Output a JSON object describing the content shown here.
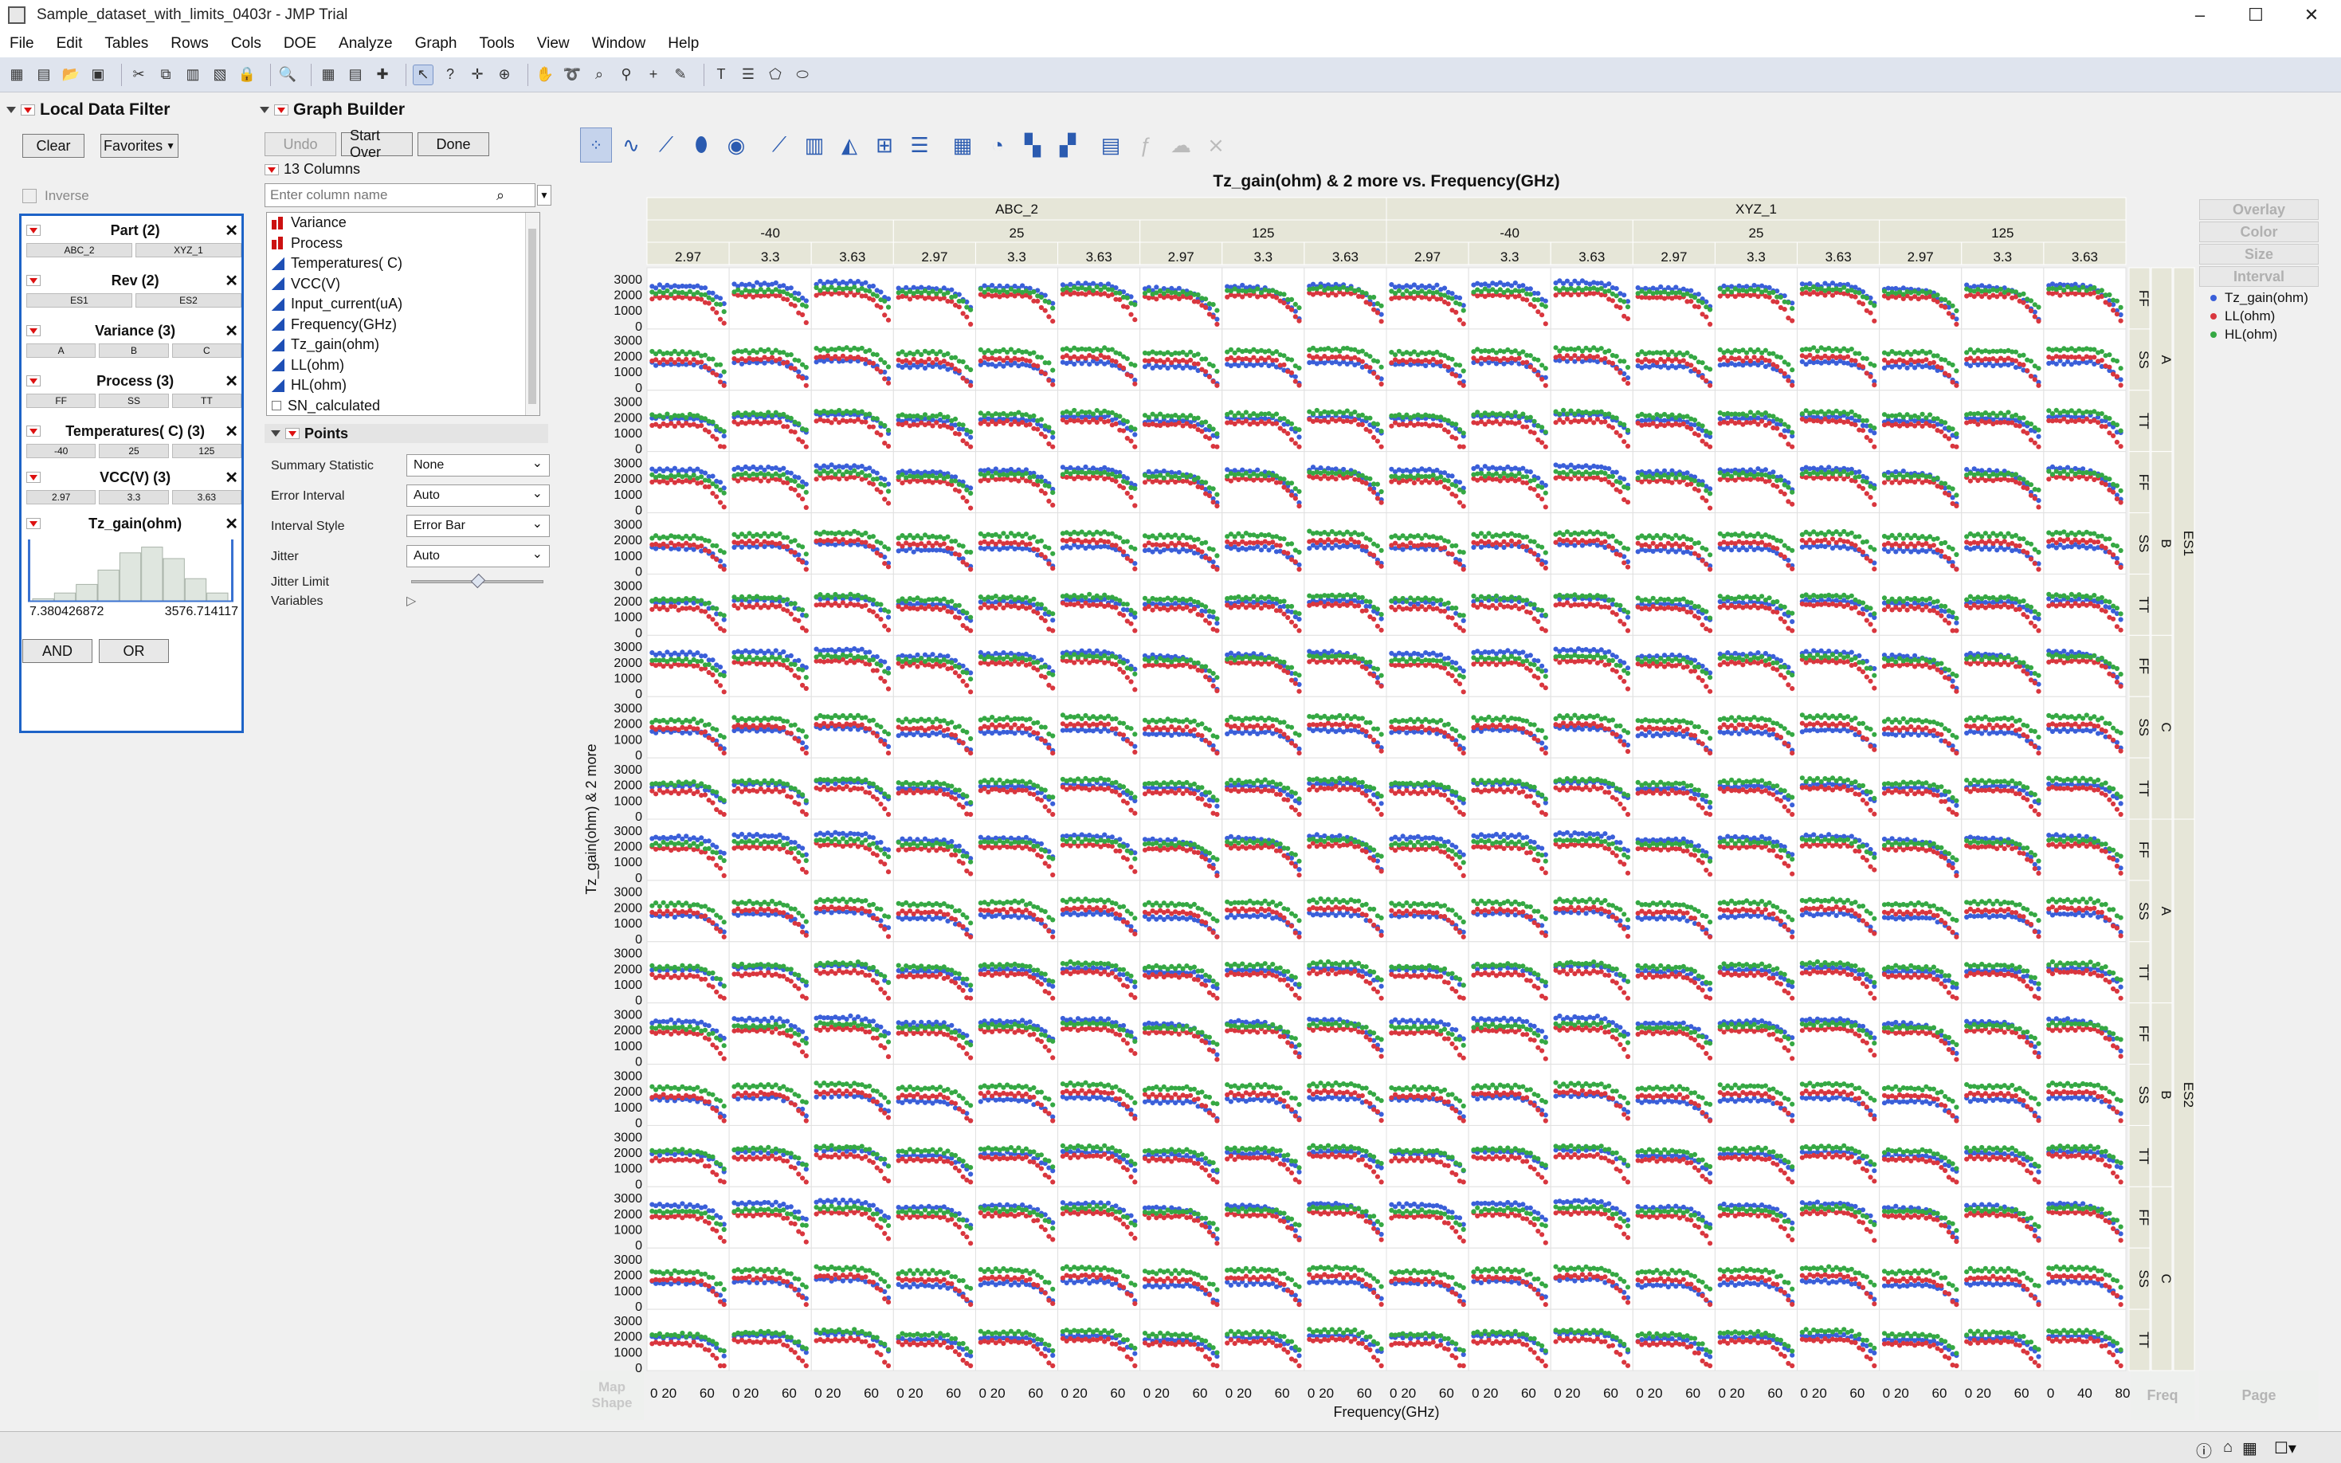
{
  "window": {
    "title": "Sample_dataset_with_limits_0403r - JMP Trial",
    "controls": [
      "–",
      "☐",
      "✕"
    ]
  },
  "menu": [
    "File",
    "Edit",
    "Tables",
    "Rows",
    "Cols",
    "DOE",
    "Analyze",
    "Graph",
    "Tools",
    "View",
    "Window",
    "Help"
  ],
  "toolbar_icons": [
    "new-table-icon",
    "new-script-icon",
    "open-icon",
    "save-icon",
    "cut-icon",
    "copy-icon",
    "paste-icon",
    "script-icon",
    "lock-icon",
    "search-icon",
    "data-table-icon",
    "grid-icon",
    "add-icon",
    "arrow-tool-icon",
    "help-tool-icon",
    "crosshair-icon",
    "brush-icon",
    "hand-icon",
    "lasso-icon",
    "magnifier-icon",
    "zoom-icon",
    "plus-icon",
    "pencil-icon",
    "text-icon",
    "lines-icon",
    "polygon-icon",
    "ellipse-icon"
  ],
  "local_data_filter": {
    "title": "Local Data Filter",
    "clear": "Clear",
    "favorites": "Favorites",
    "inverse": "Inverse",
    "filters": [
      {
        "label": "Part (2)",
        "values": [
          "ABC_2",
          "XYZ_1"
        ]
      },
      {
        "label": "Rev (2)",
        "values": [
          "ES1",
          "ES2"
        ]
      },
      {
        "label": "Variance (3)",
        "values": [
          "A",
          "B",
          "C"
        ]
      },
      {
        "label": "Process (3)",
        "values": [
          "FF",
          "SS",
          "TT"
        ]
      },
      {
        "label": "Temperatures( C) (3)",
        "values": [
          "-40",
          "25",
          "125"
        ]
      },
      {
        "label": "VCC(V) (3)",
        "values": [
          "2.97",
          "3.3",
          "3.63"
        ]
      }
    ],
    "range": {
      "label": "Tz_gain(ohm)",
      "min": "7.380426872",
      "max": "3576.714117",
      "histogram": [
        0.05,
        0.15,
        0.3,
        0.55,
        0.85,
        0.95,
        0.75,
        0.4,
        0.15
      ]
    },
    "and": "AND",
    "or": "OR"
  },
  "graph_builder": {
    "title": "Graph Builder",
    "undo": "Undo",
    "start_over": "Start Over",
    "done": "Done",
    "columns_label": "13 Columns",
    "search_placeholder": "Enter column name",
    "columns": [
      {
        "name": "Variance",
        "type": "nominal"
      },
      {
        "name": "Process",
        "type": "nominal"
      },
      {
        "name": "Temperatures( C)",
        "type": "continuous"
      },
      {
        "name": "VCC(V)",
        "type": "continuous"
      },
      {
        "name": "Input_current(uA)",
        "type": "continuous"
      },
      {
        "name": "Frequency(GHz)",
        "type": "continuous"
      },
      {
        "name": "Tz_gain(ohm)",
        "type": "continuous"
      },
      {
        "name": "LL(ohm)",
        "type": "continuous"
      },
      {
        "name": "HL(ohm)",
        "type": "continuous"
      },
      {
        "name": "SN_calculated",
        "type": "character"
      }
    ],
    "points_title": "Points",
    "properties": [
      {
        "label": "Summary Statistic",
        "value": "None"
      },
      {
        "label": "Error Interval",
        "value": "Auto"
      },
      {
        "label": "Interval Style",
        "value": "Error Bar"
      },
      {
        "label": "Jitter",
        "value": "Auto"
      }
    ],
    "jitter_limit": "Jitter Limit",
    "jitter_limit_value": 0.5,
    "variables": "Variables",
    "side_buttons": [
      "Overlay",
      "Color",
      "Size",
      "Interval"
    ],
    "map_shape": "Map Shape",
    "freq": "Freq",
    "page": "Page"
  },
  "chart_data": {
    "type": "scatter",
    "title": "Tz_gain(ohm) & 2 more vs. Frequency(GHz)",
    "xlabel": "Frequency(GHz)",
    "ylabel": "Tz_gain(ohm) & 2 more",
    "xlim": [
      0,
      80
    ],
    "ylim": [
      0,
      3500
    ],
    "y_ticks": [
      0,
      1000,
      2000,
      3000
    ],
    "x_tick_labels": [
      "0",
      "20",
      "60"
    ],
    "x_tick_labels_last": [
      "0",
      "40",
      "80"
    ],
    "group_x": {
      "parts": [
        "ABC_2",
        "XYZ_1"
      ],
      "temperatures": [
        "-40",
        "25",
        "125"
      ],
      "vcc": [
        "2.97",
        "3.3",
        "3.63"
      ]
    },
    "group_y": {
      "rev": [
        "ES1",
        "ES2"
      ],
      "variance": [
        "A",
        "B",
        "C"
      ],
      "process": [
        "FF",
        "SS",
        "TT"
      ]
    },
    "frequency_points": [
      2,
      6,
      10,
      14,
      18,
      22,
      26,
      30,
      34,
      38,
      42,
      46,
      50,
      54,
      58,
      62,
      66,
      70,
      74,
      78
    ],
    "series": [
      {
        "name": "Tz_gain(ohm)",
        "color": "#3a5fd9",
        "base_by_process": {
          "FF": 2550,
          "SS": 1500,
          "TT": 1950
        }
      },
      {
        "name": "LL(ohm)",
        "color": "#d9363e",
        "base_by_process": {
          "FF": 2000,
          "SS": 1850,
          "TT": 1700
        }
      },
      {
        "name": "HL(ohm)",
        "color": "#35a843",
        "base_by_process": {
          "FF": 2300,
          "SS": 2350,
          "TT": 2250
        }
      }
    ]
  }
}
